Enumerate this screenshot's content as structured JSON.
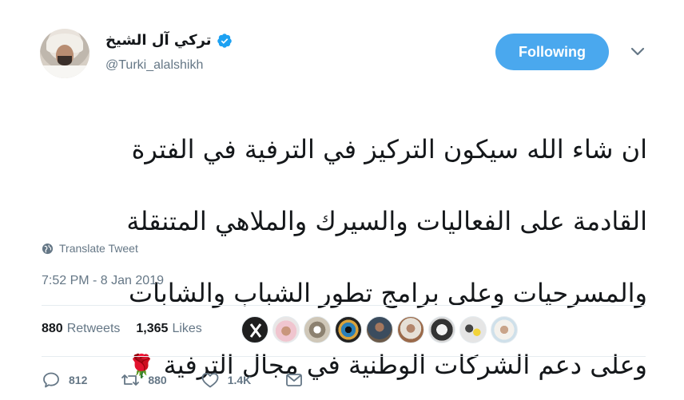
{
  "header": {
    "display_name": "تركي آل الشيخ",
    "handle": "@Turki_alalshikh",
    "verified": true,
    "follow_button_label": "Following"
  },
  "tweet": {
    "lines": [
      "ان شاء الله  سيكون التركيز في الترفية في الفترة",
      "القادمة على الفعاليات والسيرك والملاهي المتنقلة",
      "والمسرحيات وعلى برامج تطور الشباب والشابات",
      "وعلى دعم الشركات الوطنية في مجال الترفية"
    ],
    "emoji": "🌹",
    "translate_label": "Translate Tweet",
    "timestamp": "7:52 PM - 8 Jan 2019"
  },
  "stats": {
    "retweets_count": "880",
    "retweets_label": "Retweets",
    "likes_count": "1,365",
    "likes_label": "Likes"
  },
  "actions": {
    "reply_count": "812",
    "retweet_count": "880",
    "like_count": "1.4K"
  },
  "colors": {
    "accent": "#4aa8ee",
    "muted": "#657786",
    "text": "#14171a",
    "verified": "#1da1f2"
  },
  "icons": [
    "verified-badge-icon",
    "chevron-down-icon",
    "globe-icon",
    "reply-icon",
    "retweet-icon",
    "like-icon",
    "message-icon"
  ]
}
